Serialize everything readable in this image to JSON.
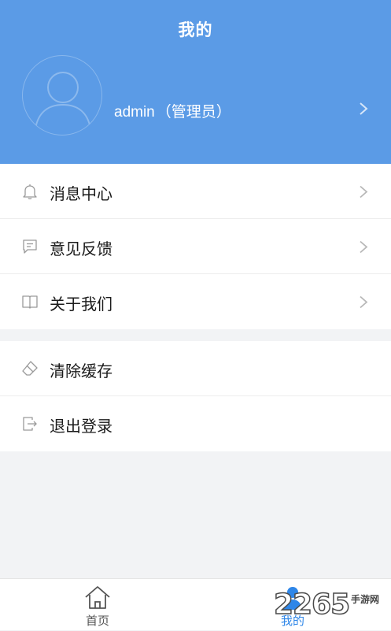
{
  "header": {
    "title": "我的",
    "bg_color": "#5b9be6"
  },
  "profile": {
    "username": "admin",
    "role": "（管理员）",
    "avatar_icon": "user-avatar-icon",
    "chevron_icon": "chevron-right-icon"
  },
  "menu_group_1": [
    {
      "label": "消息中心",
      "icon": "bell-icon"
    },
    {
      "label": "意见反馈",
      "icon": "feedback-icon"
    },
    {
      "label": "关于我们",
      "icon": "book-icon"
    }
  ],
  "menu_group_2": [
    {
      "label": "清除缓存",
      "icon": "eraser-icon"
    },
    {
      "label": "退出登录",
      "icon": "logout-icon"
    }
  ],
  "tabbar": {
    "home_label": "首页",
    "mine_label": "我的",
    "active_color": "#2e86e8"
  },
  "watermark": {
    "digits": "2265",
    "text": "手游网"
  }
}
